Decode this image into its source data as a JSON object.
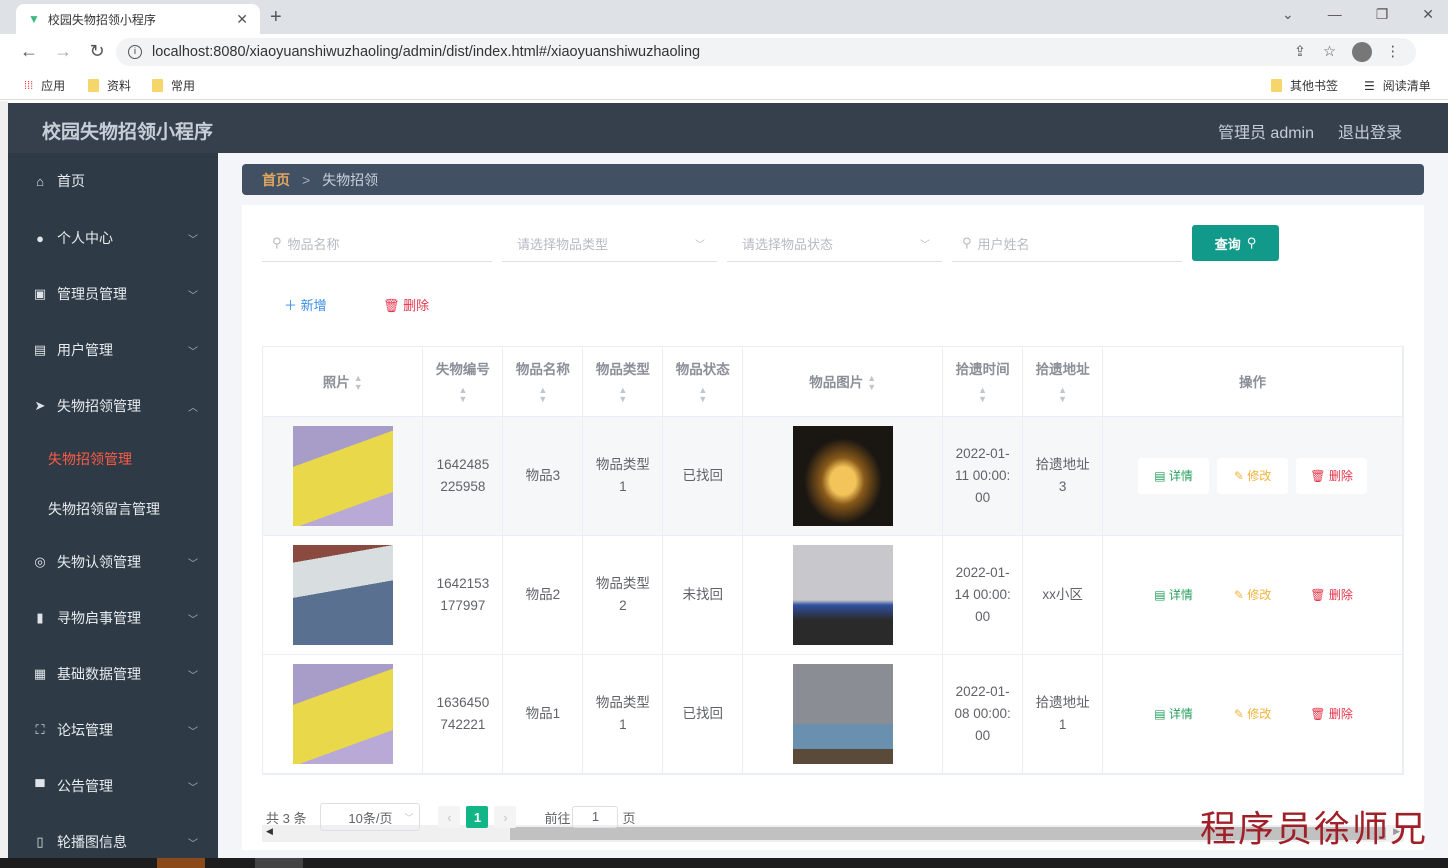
{
  "browser": {
    "tab_title": "校园失物招领小程序",
    "url": "localhost:8080/xiaoyuanshiwuzhaoling/admin/dist/index.html#/xiaoyuanshiwuzhaoling",
    "bookmarks": [
      "应用",
      "资料",
      "常用"
    ],
    "bookmarks_right": [
      "其他书签",
      "阅读清单"
    ]
  },
  "header": {
    "title": "校园失物招领小程序",
    "user": "管理员 admin",
    "logout": "退出登录"
  },
  "sidebar": {
    "items": [
      {
        "label": "首页",
        "icon": "home-icon"
      },
      {
        "label": "个人中心",
        "icon": "user-icon"
      },
      {
        "label": "管理员管理",
        "icon": "admin-icon"
      },
      {
        "label": "用户管理",
        "icon": "clipboard-icon"
      },
      {
        "label": "失物招领管理",
        "icon": "send-icon",
        "expanded": true,
        "children": [
          "失物招领管理",
          "失物招领留言管理"
        ],
        "active": "失物招领管理"
      },
      {
        "label": "失物认领管理",
        "icon": "target-icon"
      },
      {
        "label": "寻物启事管理",
        "icon": "chart-icon"
      },
      {
        "label": "基础数据管理",
        "icon": "grid-icon"
      },
      {
        "label": "论坛管理",
        "icon": "fullscreen-icon"
      },
      {
        "label": "公告管理",
        "icon": "sign-icon"
      },
      {
        "label": "轮播图信息",
        "icon": "phone-icon"
      }
    ]
  },
  "breadcrumb": {
    "home": "首页",
    "sep": ">",
    "current": "失物招领"
  },
  "filters": {
    "name_placeholder": "物品名称",
    "type_placeholder": "请选择物品类型",
    "status_placeholder": "请选择物品状态",
    "user_placeholder": "用户姓名",
    "query": "查询"
  },
  "actions": {
    "add": "新增",
    "delete": "删除"
  },
  "table": {
    "columns": [
      "照片",
      "失物编号",
      "物品名称",
      "物品类型",
      "物品状态",
      "物品图片",
      "拾遗时间",
      "拾遗地址",
      "操作"
    ],
    "rows": [
      {
        "id": "1642485225958",
        "name": "物品3",
        "type": "物品类型1",
        "status": "已找回",
        "time": "2022-01-11 00:00:00",
        "address": "拾遗地址3"
      },
      {
        "id": "1642153177997",
        "name": "物品2",
        "type": "物品类型2",
        "status": "未找回",
        "time": "2022-01-14 00:00:00",
        "address": "xx小区"
      },
      {
        "id": "1636450742221",
        "name": "物品1",
        "type": "物品类型1",
        "status": "已找回",
        "time": "2022-01-08 00:00:00",
        "address": "拾遗地址1"
      }
    ],
    "ops": {
      "detail": "详情",
      "edit": "修改",
      "delete": "删除"
    }
  },
  "pagination": {
    "total": "共 3 条",
    "page_size": "10条/页",
    "current": "1",
    "goto": "前往",
    "goto_value": "1",
    "page_unit": "页"
  },
  "watermark": "程序员徐师兄",
  "colors": {
    "header": "#36404c",
    "sidebar": "#2e3a46",
    "active": "#ff5b45",
    "primary": "#11998a"
  }
}
